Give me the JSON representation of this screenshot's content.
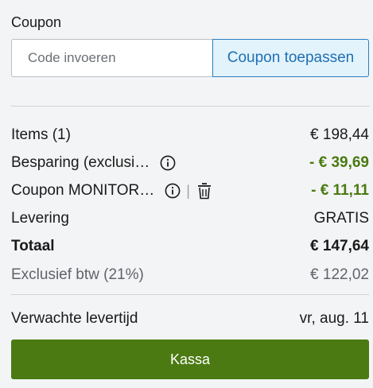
{
  "coupon": {
    "title": "Coupon",
    "input_placeholder": "Code invoeren",
    "input_value": "",
    "apply_button": "Coupon toepassen"
  },
  "summary": {
    "items_label": "Items (1)",
    "items_value": "€ 198,44",
    "savings_label": "Besparing (exclusi…",
    "savings_value": "- € 39,69",
    "coupon_label": "Coupon MONITOR…",
    "coupon_separator": "|",
    "coupon_value": "- € 11,11",
    "delivery_label": "Levering",
    "delivery_value": "GRATIS",
    "total_label": "Totaal",
    "total_value": "€ 147,64",
    "vat_label": "Exclusief btw (21%)",
    "vat_value": "€ 122,02"
  },
  "delivery_time": {
    "label": "Verwachte levertijd",
    "value": "vr, aug. 11"
  },
  "checkout": {
    "button_label": "Kassa"
  },
  "colors": {
    "accent_green": "#4b7a12",
    "discount_green": "#4a7a10",
    "coupon_button_bg": "#e2f3fc",
    "coupon_button_text": "#1f6fb2"
  },
  "icons": [
    "info-icon",
    "trash-icon"
  ]
}
